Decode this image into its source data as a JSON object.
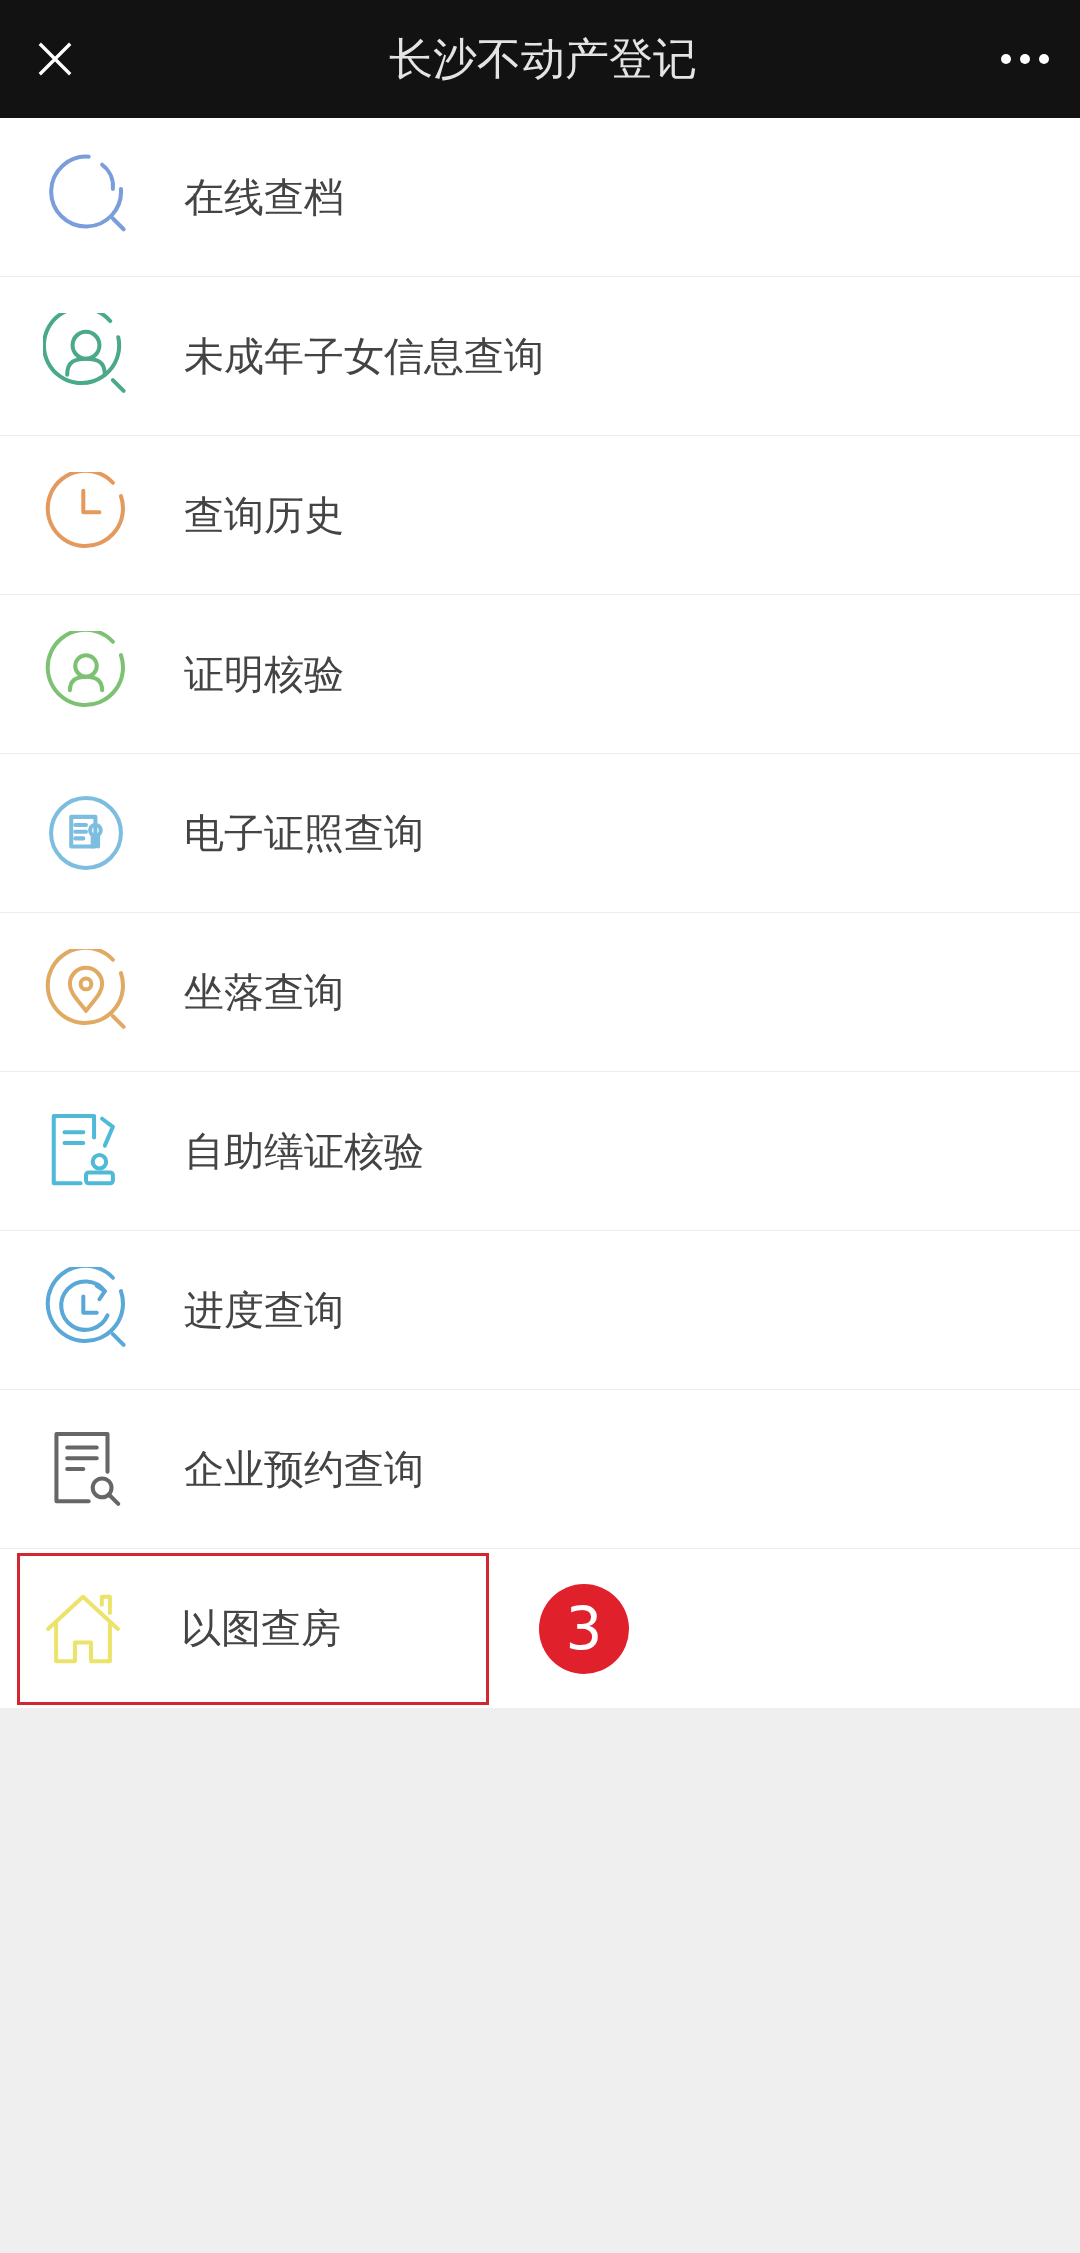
{
  "header": {
    "title": "长沙不动产登记"
  },
  "items": [
    {
      "label": "在线查档",
      "kind": "search",
      "color": "#7a9edb",
      "highlighted": false
    },
    {
      "label": "未成年子女信息查询",
      "kind": "person-search",
      "color": "#4aa98a",
      "highlighted": false
    },
    {
      "label": "查询历史",
      "kind": "clock",
      "color": "#e39a5c",
      "highlighted": false
    },
    {
      "label": "证明核验",
      "kind": "person",
      "color": "#7cc272",
      "highlighted": false
    },
    {
      "label": "电子证照查询",
      "kind": "certificate",
      "color": "#7dbde0",
      "highlighted": false
    },
    {
      "label": "坐落查询",
      "kind": "location",
      "color": "#e0aa62",
      "highlighted": false
    },
    {
      "label": "自助缮证核验",
      "kind": "stamp",
      "color": "#4fb9d8",
      "highlighted": false
    },
    {
      "label": "进度查询",
      "kind": "progress",
      "color": "#5aa8d8",
      "highlighted": false
    },
    {
      "label": "企业预约查询",
      "kind": "document",
      "color": "#666666",
      "highlighted": false
    },
    {
      "label": "以图查房",
      "kind": "house",
      "color": "#ece36a",
      "highlighted": true,
      "marker": "3"
    }
  ]
}
